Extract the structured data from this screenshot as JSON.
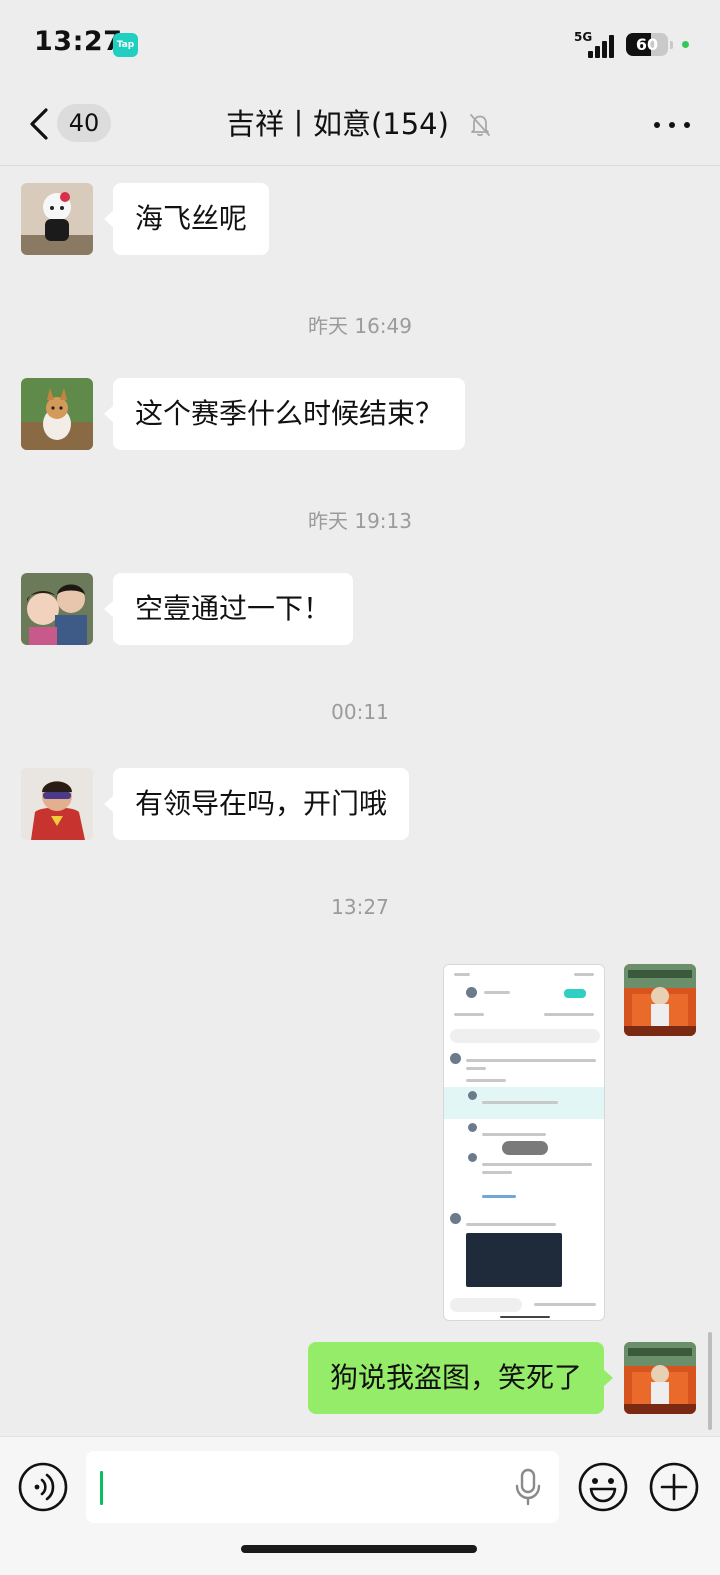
{
  "status_bar": {
    "time": "13:27",
    "app_badge": "Tap",
    "network": "5G",
    "battery": "60",
    "battery_level": 0.6
  },
  "nav": {
    "unread_count": "40",
    "title": "吉祥丨如意(154)"
  },
  "messages": [
    {
      "type": "incoming",
      "text": "海飞丝呢"
    },
    {
      "type": "time",
      "text": "昨天 16:49"
    },
    {
      "type": "incoming",
      "text": "这个赛季什么时候结束？"
    },
    {
      "type": "time",
      "text": "昨天 19:13"
    },
    {
      "type": "incoming",
      "text": "空壹通过一下！"
    },
    {
      "type": "time",
      "text": "00:11"
    },
    {
      "type": "incoming",
      "text": "有领导在吗，开门哦"
    },
    {
      "type": "time",
      "text": "13:27"
    },
    {
      "type": "outgoing-image",
      "description_icon": "screenshot-image"
    },
    {
      "type": "outgoing",
      "text": "狗说我盗图，笑死了"
    }
  ],
  "colors": {
    "background": "#ededed",
    "incoming_bubble": "#ffffff",
    "outgoing_bubble": "#95ec69",
    "caret": "#07c160"
  },
  "input": {
    "value": ""
  },
  "icons": {
    "back": "chevron-left-icon",
    "mute": "bell-off-icon",
    "more": "more-dots-icon",
    "voice": "voice-icon",
    "mic": "microphone-icon",
    "emoji": "emoji-icon",
    "add": "plus-icon"
  }
}
